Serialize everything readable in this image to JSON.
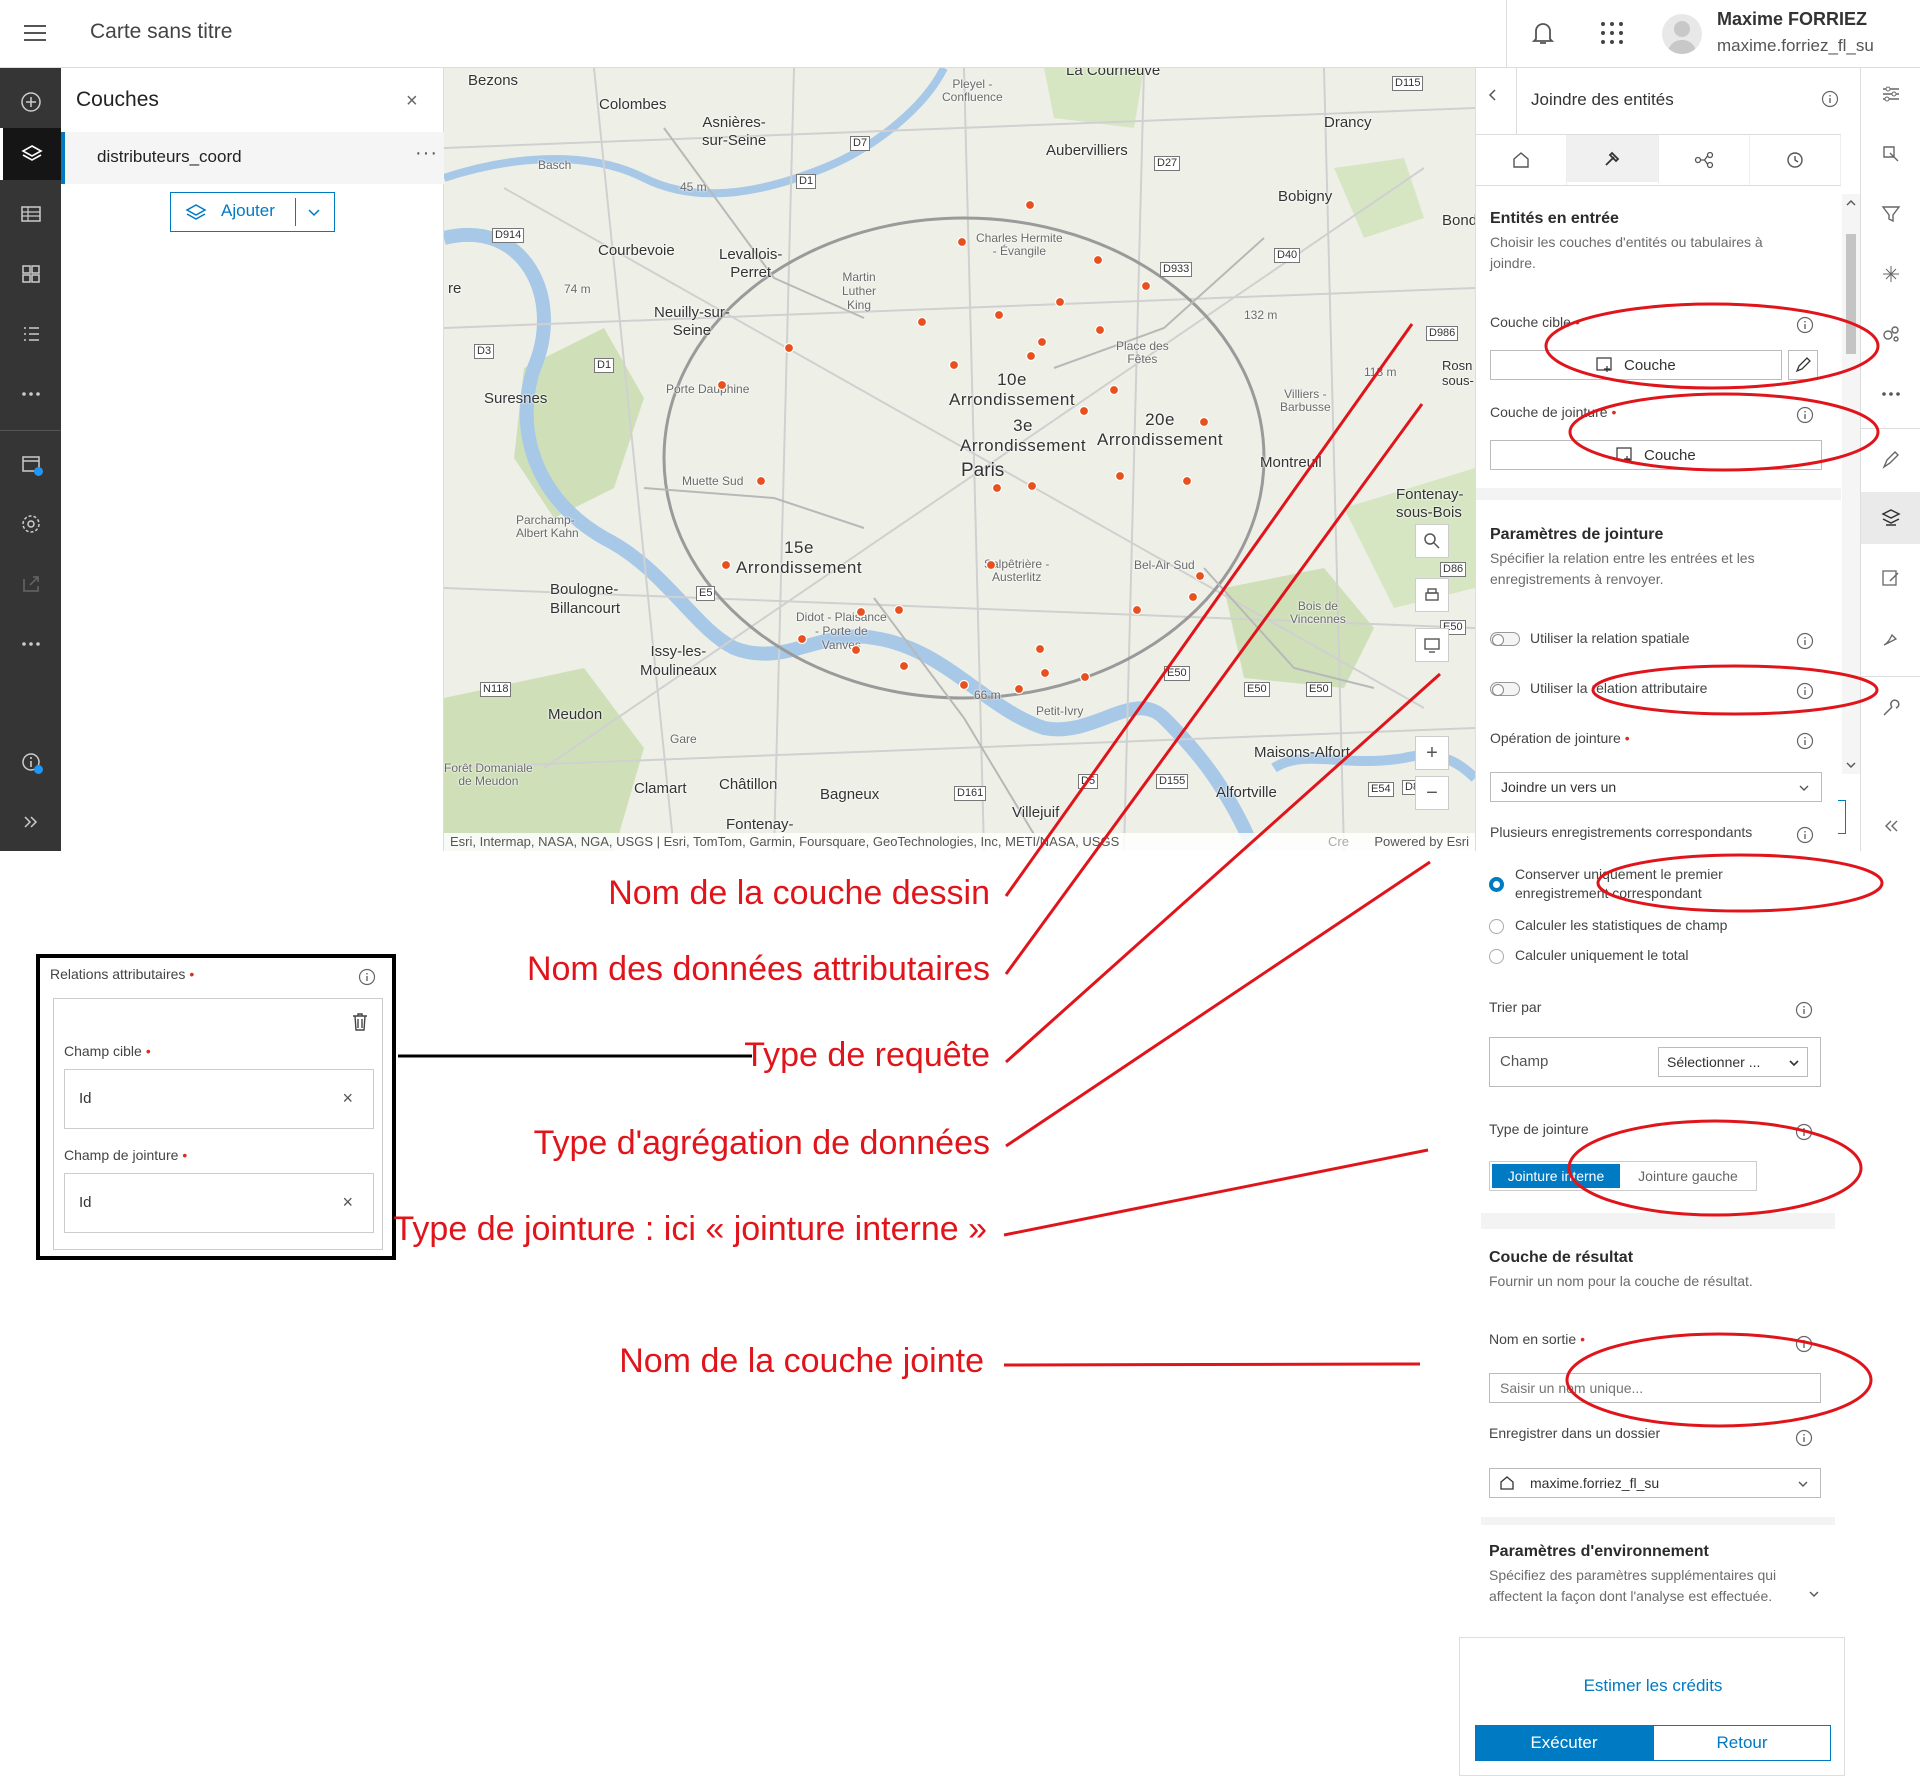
{
  "header": {
    "map_title": "Carte sans titre",
    "user_name": "Maxime FORRIEZ",
    "user_login": "maxime.forriez_fl_su"
  },
  "layers_panel": {
    "title": "Couches",
    "close": "×",
    "layer_name": "distributeurs_coord",
    "layer_more": "···",
    "add_label": "Ajouter"
  },
  "map": {
    "labels": {
      "bezons": "Bezons",
      "colombes": "Colombes",
      "asnieres": "Asnières-\nsur-Seine",
      "aubervilliers": "Aubervilliers",
      "drancy": "Drancy",
      "bobigny": "Bobigny",
      "bondy": "Bond",
      "courbevoie": "Courbevoie",
      "levallois": "Levallois-\nPerret",
      "neuilly": "Neuilly-sur-\nSeine",
      "suresnes": "Suresnes",
      "arr10": "10e\nArrondissement",
      "arr3": "3e\nArrondissement",
      "arr20": "20e\nArrondissement",
      "paris": "Paris",
      "montreuil": "Montreuil",
      "fontenay_bois": "Fontenay-\nsous-Bois",
      "arr15": "15e\nArrondissement",
      "boulogne": "Boulogne-\nBillancourt",
      "issy": "Issy-les-\nMoulineaux",
      "meudon": "Meudon",
      "clamart": "Clamart",
      "chatillon": "Châtillon",
      "bagneux": "Bagneux",
      "villejuif": "Villejuif",
      "alfortville": "Alfortville",
      "maisons_alfort": "Maisons-Alfort",
      "fontenay": "Fontenay-",
      "re": "re",
      "rosny": "Rosn\nsous-",
      "courneuve": "La Courneuve",
      "basch": "Basch",
      "porte_dauphine": "Porte Dauphine",
      "muette": "Muette Sud",
      "parchamp": "Parchamp-\nAlbert Kahn",
      "mlk": "Martin\nLuther\nKing",
      "charles_hermite": "Charles Hermite\n- Évangile",
      "place_fetes": "Place des\nFêtes",
      "villiers": "Villiers -\nBarbusse",
      "salpetriere": "Salpêtrière -\nAusterlitz",
      "bel_air": "Bel-Air Sud",
      "didot": "Didot - Plaisance\n- Porte de\nVanves",
      "petit_ivry": "Petit-Ivry",
      "bois_vincennes": "Bois de\nVincennes",
      "gare": "Gare",
      "foret_meudon": "Forêt Domaniale\nde Meudon",
      "pleyel": "Pleyel -\nConfluence",
      "m45": "45 m",
      "m74": "74 m",
      "m132": "132 m",
      "m118": "118 m",
      "m66": "66 m"
    },
    "roads": [
      "D115",
      "D7",
      "D1",
      "D27",
      "D914",
      "D40",
      "D933",
      "D986",
      "D3",
      "D1",
      "D86",
      "E5",
      "E50",
      "N118",
      "E50",
      "E50",
      "E50",
      "E54",
      "D5",
      "D155",
      "D161",
      "D8"
    ],
    "attribution": "Esri, Intermap, NASA, NGA, USGS | Esri, TomTom, Garmin, Foursquare, GeoTechnologies, Inc, METI/NASA, USGS",
    "attribution_cre": "Cre",
    "powered": "Powered by Esri",
    "zoom_in": "+",
    "zoom_out": "−",
    "point_color": "#e8501e"
  },
  "tool_panel": {
    "title": "Joindre des entités",
    "entrees_title": "Entités en entrée",
    "entrees_desc": "Choisir les couches d'entités ou tabulaires à joindre.",
    "couche_cible": "Couche cible",
    "couche_btn": "Couche",
    "couche_jointure": "Couche de jointure",
    "couche_btn2": "Couche",
    "params_title": "Paramètres de jointure",
    "params_desc": "Spécifier la relation entre les entrées et les enregistrements à renvoyer.",
    "rel_spatiale": "Utiliser la relation spatiale",
    "rel_attributaire": "Utiliser la relation attributaire",
    "operation": "Opération de jointure",
    "operation_value": "Joindre un vers un",
    "plusieurs": "Plusieurs enregistrements correspondants",
    "radio1": "Conserver uniquement le premier enregistrement correspondant",
    "radio2": "Calculer les statistiques de champ",
    "radio3": "Calculer uniquement le total",
    "trier": "Trier par",
    "champ": "Champ",
    "selectionner": "Sélectionner ...",
    "type_jointure": "Type de jointure",
    "jointure_interne": "Jointure interne",
    "jointure_gauche": "Jointure gauche",
    "resultat_title": "Couche de résultat",
    "resultat_desc": "Fournir un nom pour la couche de résultat.",
    "nom_sortie": "Nom en sortie",
    "nom_placeholder": "Saisir un nom unique...",
    "enregistrer": "Enregistrer dans un dossier",
    "dossier": "maxime.forriez_fl_su",
    "env_title": "Paramètres d'environnement",
    "env_desc": "Spécifiez des paramètres supplémentaires qui affectent la façon dont l'analyse est effectuée.",
    "estimer": "Estimer les crédits",
    "executer": "Exécuter",
    "retour": "Retour",
    "accent": "#007ac2"
  },
  "relations_box": {
    "title": "Relations attributaires",
    "champ_cible": "Champ cible",
    "champ_cible_value": "Id",
    "champ_jointure": "Champ de jointure",
    "champ_jointure_value": "Id"
  },
  "annotations": {
    "a1": "Nom de la couche dessin",
    "a2": "Nom des données attributaires",
    "a3": "Type de requête",
    "a4": "Type d'agrégation de données",
    "a5": "Type de jointure : ici « jointure  interne »",
    "a6": "Nom de la couche jointe",
    "color": "#e0151b"
  }
}
